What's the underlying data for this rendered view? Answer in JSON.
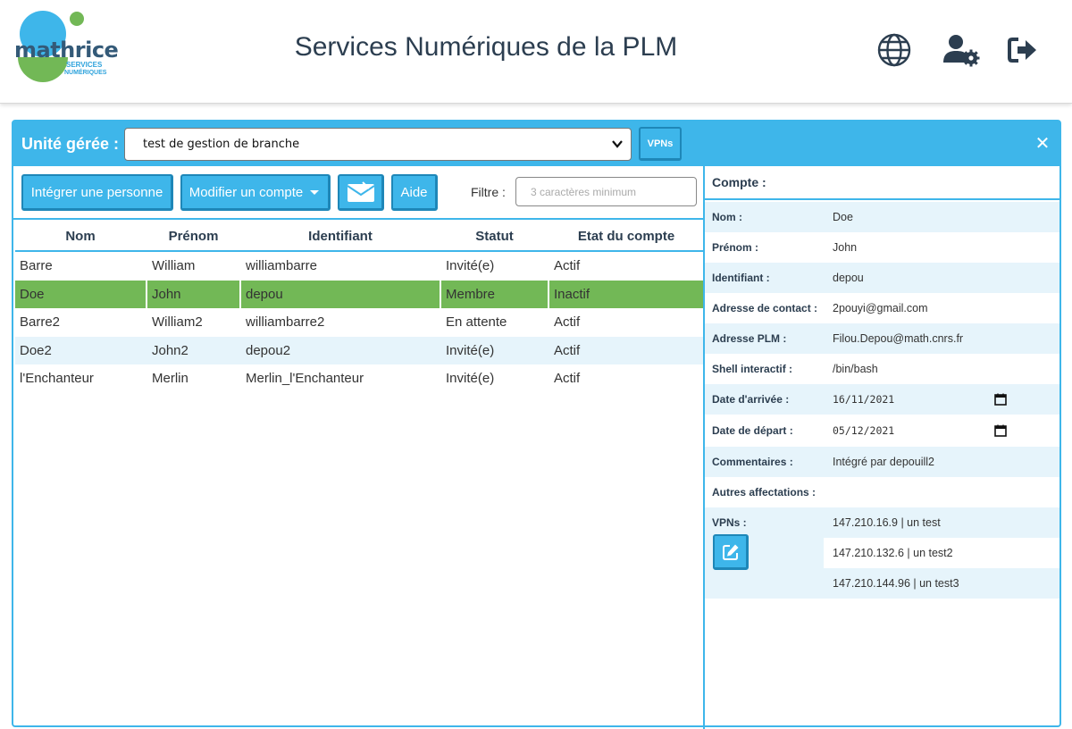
{
  "header": {
    "logo_text": "mathrice",
    "logo_sub1": "SERVICES",
    "logo_sub2": "NUMÉRIQUES",
    "title": "Services Numériques de la PLM",
    "icons": [
      "globe-icon",
      "user-gear-icon",
      "logout-icon"
    ]
  },
  "colors": {
    "accent": "#3eb6ea",
    "selected_row": "#72b856",
    "alt_row": "#e6f4fb",
    "logo_green": "#72b856",
    "logo_blue": "#3eb6ea"
  },
  "unit_bar": {
    "label": "Unité gérée :",
    "selected_unit": "test de gestion de branche",
    "vpns_label": "VPNs",
    "close_label": "✕"
  },
  "toolbar": {
    "integrate_label": "Intégrer une personne",
    "modify_label": "Modifier un compte",
    "help_label": "Aide",
    "filter_label": "Filtre :",
    "filter_placeholder": "3 caractères minimum"
  },
  "table": {
    "columns": [
      "Nom",
      "Prénom",
      "Identifiant",
      "Statut",
      "Etat du compte"
    ],
    "rows": [
      [
        "Barre",
        "William",
        "williambarre",
        "Invité(e)",
        "Actif"
      ],
      [
        "Doe",
        "John",
        "depou",
        "Membre",
        "Inactif"
      ],
      [
        "Barre2",
        "William2",
        "williambarre2",
        "En attente",
        "Actif"
      ],
      [
        "Doe2",
        "John2",
        "depou2",
        "Invité(e)",
        "Actif"
      ],
      [
        "l'Enchanteur",
        "Merlin",
        "Merlin_l'Enchanteur",
        "Invité(e)",
        "Actif"
      ]
    ]
  },
  "account": {
    "title": "Compte :",
    "fields": [
      {
        "label": "Nom :",
        "value": "Doe"
      },
      {
        "label": "Prénom :",
        "value": "John"
      },
      {
        "label": "Identifiant :",
        "value": "depou"
      },
      {
        "label": "Adresse de contact :",
        "value": "2pouyi@gmail.com"
      },
      {
        "label": "Adresse PLM :",
        "value": "Filou.Depou@math.cnrs.fr"
      },
      {
        "label": "Shell interactif :",
        "value": "/bin/bash"
      },
      {
        "label": "Date d'arrivée :",
        "value": "16/11/2021"
      },
      {
        "label": "Date de départ :",
        "value": "05/12/2021"
      },
      {
        "label": "Commentaires :",
        "value": "Intégré par depouill2"
      },
      {
        "label": "Autres affectations :",
        "value": ""
      }
    ],
    "vpns_label": "VPNs :",
    "vpns": [
      "147.210.16.9 | un test",
      "147.210.132.6 | un test2",
      "147.210.144.96 | un test3"
    ]
  }
}
